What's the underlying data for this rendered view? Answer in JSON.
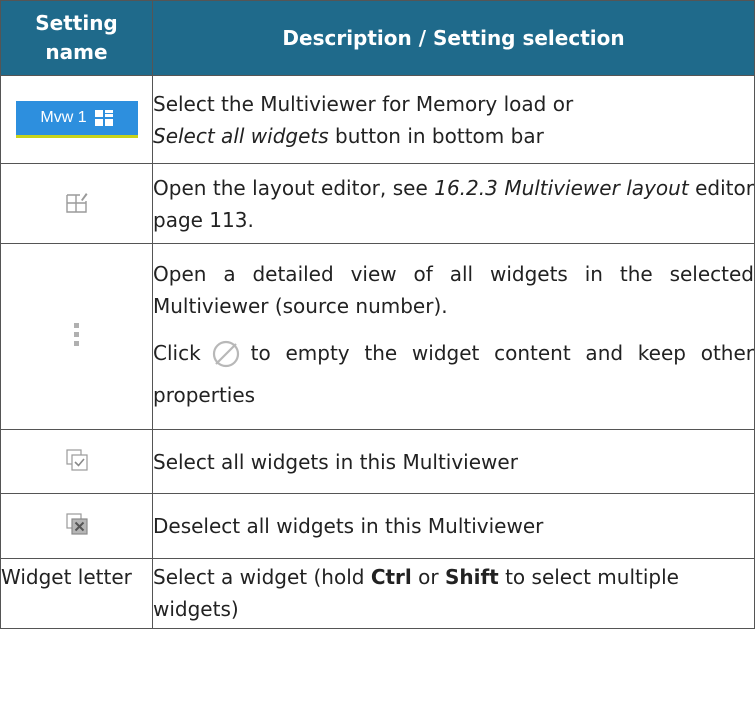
{
  "headers": {
    "setting_name": "Setting name",
    "description": "Description / Setting selection"
  },
  "rows": [
    {
      "icon": "multiviewer-select-button",
      "button_label": "Mvw 1",
      "desc": {
        "a": "Select the Multiviewer for Memory load or",
        "b": "Select all widgets",
        "c": " button in bottom bar"
      }
    },
    {
      "icon": "layout-editor-icon",
      "desc": {
        "a": "Open the layout editor, see ",
        "b": "16.2.3 Multiviewer layout",
        "c": " editor page 113."
      }
    },
    {
      "icon": "more-vertical-icon",
      "desc": {
        "a": "Open a detailed view of all widgets in the selected Multiviewer (source number).",
        "b": "Click",
        "c": "to empty the widget content and keep other properties"
      }
    },
    {
      "icon": "select-all-icon",
      "desc": {
        "a": "Select all widgets in this Multiviewer"
      }
    },
    {
      "icon": "deselect-all-icon",
      "desc": {
        "a": "Deselect all widgets in this Multiviewer"
      }
    },
    {
      "name": "Widget letter",
      "desc": {
        "a": "Select a widget (hold ",
        "b": "Ctrl",
        "c": " or ",
        "d": "Shift",
        "e": " to select multiple widgets)"
      }
    }
  ],
  "colors": {
    "header_bg": "#1f6a8b",
    "button_bg": "#2d8fde",
    "button_underline": "#c8d31a"
  }
}
